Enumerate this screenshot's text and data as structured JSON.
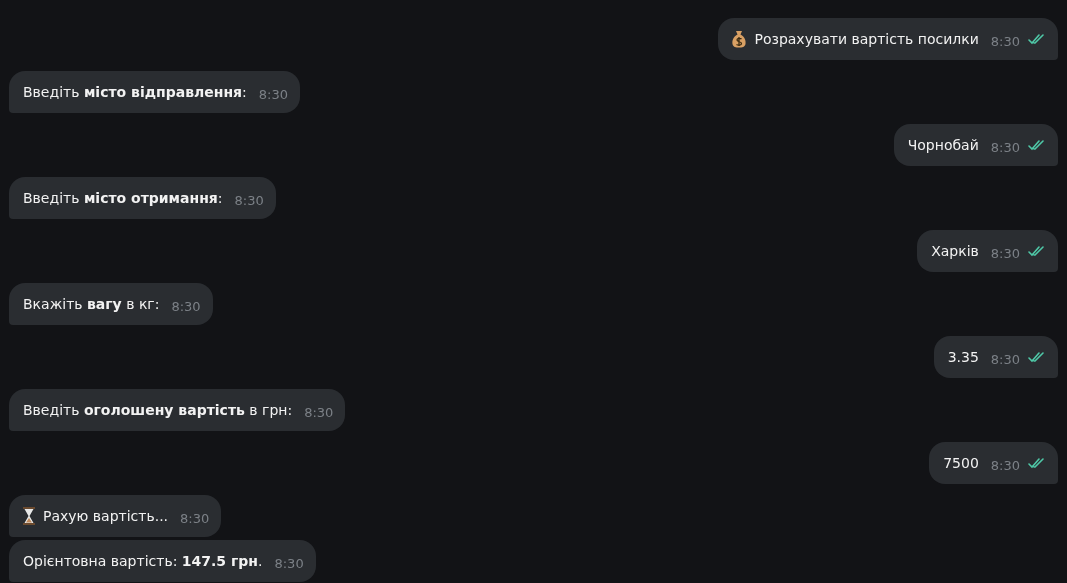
{
  "messages": [
    {
      "outgoing": true,
      "kind": "command",
      "text": "Розрахувати вартість посилки",
      "time": "8:30",
      "read": true
    },
    {
      "outgoing": false,
      "kind": "text",
      "text": "Введіть **місто відправлення**:",
      "time": "8:30"
    },
    {
      "outgoing": true,
      "kind": "text",
      "text": "Чорнобай",
      "time": "8:30",
      "read": true
    },
    {
      "outgoing": false,
      "kind": "text",
      "text": "Введіть **місто отримання**:",
      "time": "8:30"
    },
    {
      "outgoing": true,
      "kind": "text",
      "text": "Харків",
      "time": "8:30",
      "read": true
    },
    {
      "outgoing": false,
      "kind": "text",
      "text": "Вкажіть **вагу** в кг:",
      "time": "8:30"
    },
    {
      "outgoing": true,
      "kind": "text",
      "text": "3.35",
      "time": "8:30",
      "read": true
    },
    {
      "outgoing": false,
      "kind": "text",
      "text": "Введіть **оголошену вартість** в грн:",
      "time": "8:30"
    },
    {
      "outgoing": true,
      "kind": "text",
      "text": "7500",
      "time": "8:30",
      "read": true
    },
    {
      "outgoing": false,
      "kind": "progress",
      "text": "Рахую вартість...",
      "time": "8:30"
    },
    {
      "outgoing": false,
      "kind": "text",
      "text": "Орієнтовна вартість: **147.5 грн**.",
      "time": "8:30"
    }
  ]
}
